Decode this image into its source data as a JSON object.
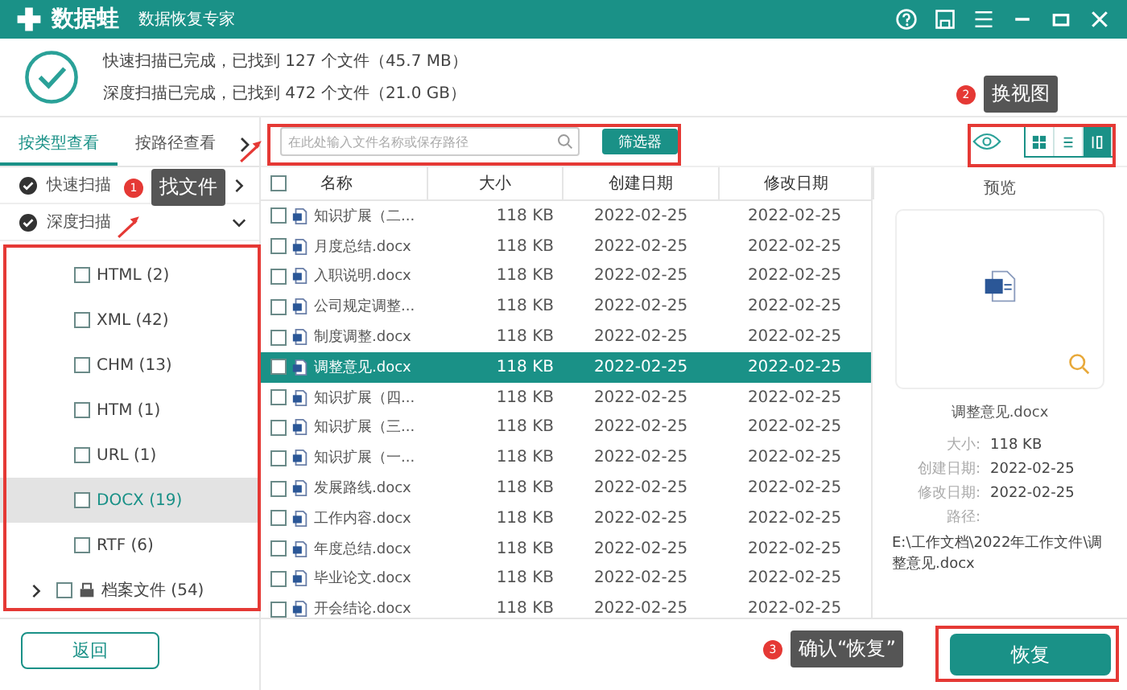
{
  "app": {
    "name": "数据蛙",
    "tagline": "数据恢复专家"
  },
  "summary": [
    "快速扫描已完成，已找到 127 个文件（45.7 MB）",
    "深度扫描已完成，已找到 472 个文件（21.0 GB）"
  ],
  "view_tabs": [
    {
      "label": "按类型查看",
      "selected": true
    },
    {
      "label": "按路径查看",
      "selected": false
    }
  ],
  "scans": [
    {
      "label": "快速扫描",
      "expanded": false
    },
    {
      "label": "深度扫描",
      "expanded": true
    }
  ],
  "file_types": [
    {
      "kind": "type",
      "label": "HTML (2)",
      "checked": false,
      "selected": false
    },
    {
      "kind": "type",
      "label": "XML (42)",
      "checked": false,
      "selected": false
    },
    {
      "kind": "type",
      "label": "CHM (13)",
      "checked": false,
      "selected": false
    },
    {
      "kind": "type",
      "label": "HTM (1)",
      "checked": false,
      "selected": false
    },
    {
      "kind": "type",
      "label": "URL (1)",
      "checked": false,
      "selected": false
    },
    {
      "kind": "type",
      "label": "DOCX (19)",
      "checked": false,
      "selected": true
    },
    {
      "kind": "type",
      "label": "RTF (6)",
      "checked": false,
      "selected": false
    },
    {
      "kind": "folder",
      "label": "档案文件 (54)",
      "checked": false,
      "selected": false,
      "expanded": false
    }
  ],
  "back_button": "返回",
  "search": {
    "placeholder": "在此处输入文件名称或保存路径"
  },
  "filter_button": "筛选器",
  "view_modes": [
    {
      "kind": "grid",
      "selected": false
    },
    {
      "kind": "list",
      "selected": false
    },
    {
      "kind": "detail",
      "selected": true
    }
  ],
  "table": {
    "select_all_checked": false,
    "columns": [
      "名称",
      "大小",
      "创建日期",
      "修改日期"
    ],
    "rows": [
      {
        "name": "知识扩展（二...",
        "size": "118 KB",
        "created": "2022-02-25",
        "modified": "2022-02-25",
        "checked": false,
        "selected": false
      },
      {
        "name": "月度总结.docx",
        "size": "118 KB",
        "created": "2022-02-25",
        "modified": "2022-02-25",
        "checked": false,
        "selected": false
      },
      {
        "name": "入职说明.docx",
        "size": "118 KB",
        "created": "2022-02-25",
        "modified": "2022-02-25",
        "checked": false,
        "selected": false
      },
      {
        "name": "公司规定调整...",
        "size": "118 KB",
        "created": "2022-02-25",
        "modified": "2022-02-25",
        "checked": false,
        "selected": false
      },
      {
        "name": "制度调整.docx",
        "size": "118 KB",
        "created": "2022-02-25",
        "modified": "2022-02-25",
        "checked": false,
        "selected": false
      },
      {
        "name": "调整意见.docx",
        "size": "118 KB",
        "created": "2022-02-25",
        "modified": "2022-02-25",
        "checked": false,
        "selected": true
      },
      {
        "name": "知识扩展（四...",
        "size": "118 KB",
        "created": "2022-02-25",
        "modified": "2022-02-25",
        "checked": false,
        "selected": false
      },
      {
        "name": "知识扩展（三...",
        "size": "118 KB",
        "created": "2022-02-25",
        "modified": "2022-02-25",
        "checked": false,
        "selected": false
      },
      {
        "name": "知识扩展（一...",
        "size": "118 KB",
        "created": "2022-02-25",
        "modified": "2022-02-25",
        "checked": false,
        "selected": false
      },
      {
        "name": "发展路线.docx",
        "size": "118 KB",
        "created": "2022-02-25",
        "modified": "2022-02-25",
        "checked": false,
        "selected": false
      },
      {
        "name": "工作内容.docx",
        "size": "118 KB",
        "created": "2022-02-25",
        "modified": "2022-02-25",
        "checked": false,
        "selected": false
      },
      {
        "name": "年度总结.docx",
        "size": "118 KB",
        "created": "2022-02-25",
        "modified": "2022-02-25",
        "checked": false,
        "selected": false
      },
      {
        "name": "毕业论文.docx",
        "size": "118 KB",
        "created": "2022-02-25",
        "modified": "2022-02-25",
        "checked": false,
        "selected": false
      },
      {
        "name": "开会结论.docx",
        "size": "118 KB",
        "created": "2022-02-25",
        "modified": "2022-02-25",
        "checked": false,
        "selected": false
      }
    ]
  },
  "preview": {
    "title": "预览",
    "file_name": "调整意见.docx",
    "fields": [
      {
        "label": "大小:",
        "value": "118 KB"
      },
      {
        "label": "创建日期:",
        "value": "2022-02-25"
      },
      {
        "label": "修改日期:",
        "value": "2022-02-25"
      }
    ],
    "path_label": "路径:",
    "path": "E:\\工作文档\\2022年工作文件\\调整意见.docx"
  },
  "recover_button": "恢复",
  "annotations": [
    {
      "number": "1",
      "label": "找文件"
    },
    {
      "number": "2",
      "label": "换视图"
    },
    {
      "number": "3",
      "label": "确认“恢复”"
    }
  ]
}
